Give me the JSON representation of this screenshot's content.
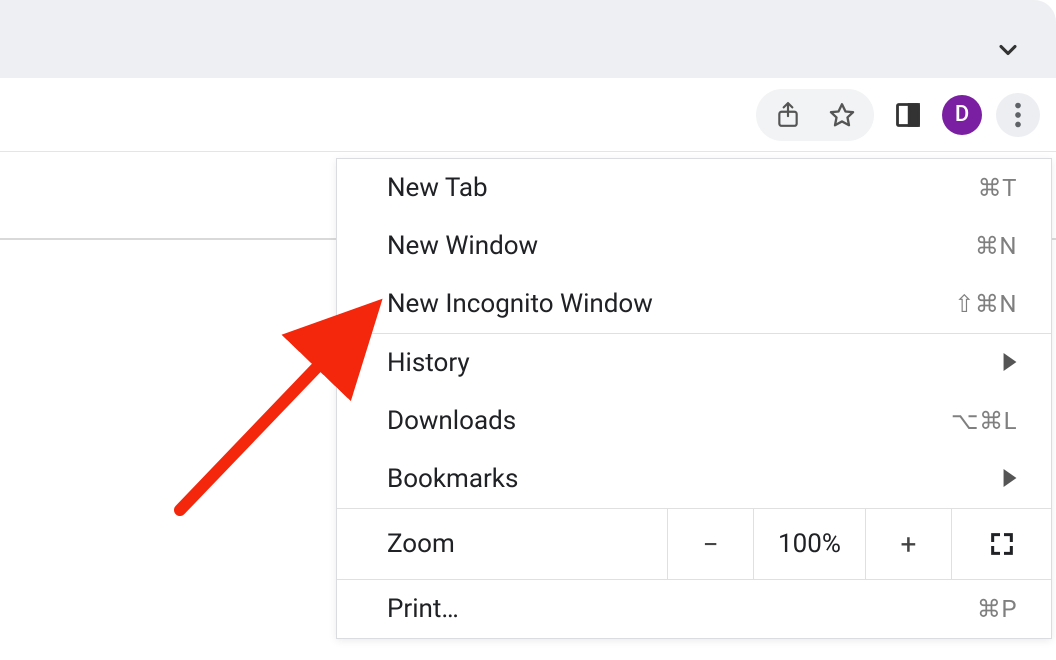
{
  "toolbar": {
    "avatar_initial": "D"
  },
  "menu": {
    "items": [
      {
        "label": "New Tab",
        "shortcut": "⌘T"
      },
      {
        "label": "New Window",
        "shortcut": "⌘N"
      },
      {
        "label": "New Incognito Window",
        "shortcut": "⇧⌘N"
      }
    ],
    "items2": [
      {
        "label": "History",
        "submenu": true
      },
      {
        "label": "Downloads",
        "shortcut": "⌥⌘L"
      },
      {
        "label": "Bookmarks",
        "submenu": true
      }
    ],
    "zoom": {
      "label": "Zoom",
      "value": "100%",
      "minus": "−",
      "plus": "+"
    },
    "print": {
      "label": "Print…",
      "shortcut": "⌘P"
    }
  }
}
